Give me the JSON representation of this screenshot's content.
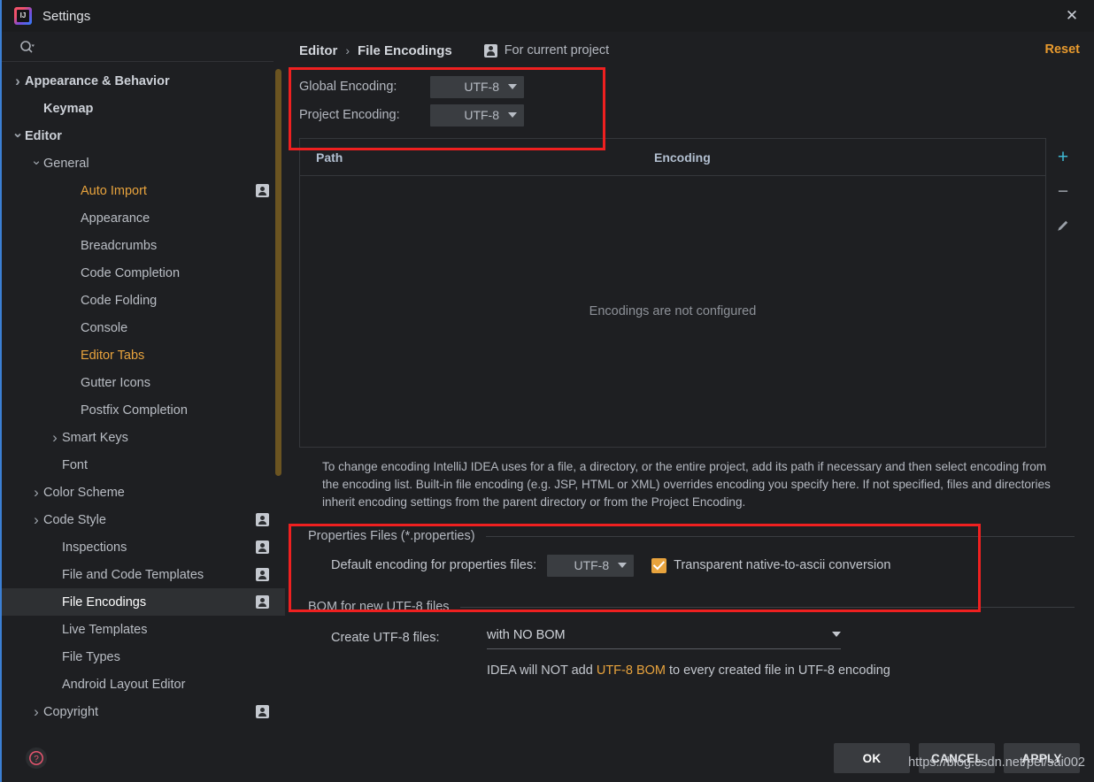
{
  "window": {
    "title": "Settings",
    "logo_icon": "intellij-idea-logo",
    "close_icon": "close-icon"
  },
  "sidebar": {
    "search": {
      "icon": "search-icon",
      "placeholder": ""
    },
    "items": [
      {
        "label": "Appearance & Behavior",
        "indent": 0,
        "twisty": "right",
        "bold": true,
        "badge": false,
        "state": "normal"
      },
      {
        "label": "Keymap",
        "indent": 1,
        "twisty": "none",
        "bold": true,
        "badge": false,
        "state": "normal"
      },
      {
        "label": "Editor",
        "indent": 0,
        "twisty": "down",
        "bold": true,
        "badge": false,
        "state": "normal"
      },
      {
        "label": "General",
        "indent": 1,
        "twisty": "down",
        "bold": false,
        "badge": false,
        "state": "normal"
      },
      {
        "label": "Auto Import",
        "indent": 3,
        "twisty": "none",
        "bold": false,
        "badge": true,
        "state": "orange"
      },
      {
        "label": "Appearance",
        "indent": 3,
        "twisty": "none",
        "bold": false,
        "badge": false,
        "state": "normal"
      },
      {
        "label": "Breadcrumbs",
        "indent": 3,
        "twisty": "none",
        "bold": false,
        "badge": false,
        "state": "normal"
      },
      {
        "label": "Code Completion",
        "indent": 3,
        "twisty": "none",
        "bold": false,
        "badge": false,
        "state": "normal"
      },
      {
        "label": "Code Folding",
        "indent": 3,
        "twisty": "none",
        "bold": false,
        "badge": false,
        "state": "normal"
      },
      {
        "label": "Console",
        "indent": 3,
        "twisty": "none",
        "bold": false,
        "badge": false,
        "state": "normal"
      },
      {
        "label": "Editor Tabs",
        "indent": 3,
        "twisty": "none",
        "bold": false,
        "badge": false,
        "state": "orange"
      },
      {
        "label": "Gutter Icons",
        "indent": 3,
        "twisty": "none",
        "bold": false,
        "badge": false,
        "state": "normal"
      },
      {
        "label": "Postfix Completion",
        "indent": 3,
        "twisty": "none",
        "bold": false,
        "badge": false,
        "state": "normal"
      },
      {
        "label": "Smart Keys",
        "indent": 2,
        "twisty": "right",
        "bold": false,
        "badge": false,
        "state": "normal"
      },
      {
        "label": "Font",
        "indent": 2,
        "twisty": "none",
        "bold": false,
        "badge": false,
        "state": "normal"
      },
      {
        "label": "Color Scheme",
        "indent": 1,
        "twisty": "right",
        "bold": false,
        "badge": false,
        "state": "normal"
      },
      {
        "label": "Code Style",
        "indent": 1,
        "twisty": "right",
        "bold": false,
        "badge": true,
        "state": "normal"
      },
      {
        "label": "Inspections",
        "indent": 2,
        "twisty": "none",
        "bold": false,
        "badge": true,
        "state": "normal"
      },
      {
        "label": "File and Code Templates",
        "indent": 2,
        "twisty": "none",
        "bold": false,
        "badge": true,
        "state": "normal"
      },
      {
        "label": "File Encodings",
        "indent": 2,
        "twisty": "none",
        "bold": false,
        "badge": true,
        "state": "selected"
      },
      {
        "label": "Live Templates",
        "indent": 2,
        "twisty": "none",
        "bold": false,
        "badge": false,
        "state": "normal"
      },
      {
        "label": "File Types",
        "indent": 2,
        "twisty": "none",
        "bold": false,
        "badge": false,
        "state": "normal"
      },
      {
        "label": "Android Layout Editor",
        "indent": 2,
        "twisty": "none",
        "bold": false,
        "badge": false,
        "state": "normal"
      },
      {
        "label": "Copyright",
        "indent": 1,
        "twisty": "right",
        "bold": false,
        "badge": true,
        "state": "normal"
      }
    ],
    "help_icon": "help-question-icon"
  },
  "header": {
    "breadcrumb_parent": "Editor",
    "breadcrumb_separator": "›",
    "breadcrumb_current": "File Encodings",
    "scope_badge_icon": "project-scope-icon",
    "scope_label": "For current project",
    "reset_label": "Reset",
    "reset_color": "#e89a2e"
  },
  "encodings": {
    "global_label": "Global Encoding:",
    "global_value": "UTF-8",
    "project_label": "Project Encoding:",
    "project_value": "UTF-8"
  },
  "table": {
    "columns": [
      "Path",
      "Encoding"
    ],
    "rows": [],
    "empty_message": "Encodings are not configured",
    "toolbar": [
      {
        "icon": "add-icon",
        "glyph": "+",
        "color": "#3fb9d4"
      },
      {
        "icon": "remove-icon",
        "glyph": "−",
        "color": "#9aa0a8"
      },
      {
        "icon": "edit-pencil-icon",
        "glyph": "",
        "color": "#9aa0a8"
      }
    ]
  },
  "description": "To change encoding IntelliJ IDEA uses for a file, a directory, or the entire project, add its path if necessary and then select encoding from the encoding list. Built-in file encoding (e.g. JSP, HTML or XML) overrides encoding you specify here. If not specified, files and directories inherit encoding settings from the parent directory or from the Project Encoding.",
  "properties_section": {
    "title": "Properties Files (*.properties)",
    "encoding_label": "Default encoding for properties files:",
    "encoding_value": "UTF-8",
    "checkbox_label": "Transparent native-to-ascii conversion",
    "checkbox_checked": true,
    "checkbox_color": "#e8a33d"
  },
  "bom_section": {
    "title": "BOM for new UTF-8 files",
    "create_label": "Create UTF-8 files:",
    "create_value": "with NO BOM",
    "note_prefix": "IDEA will NOT add ",
    "note_highlight": "UTF-8 BOM",
    "note_suffix": " to every created file in UTF-8 encoding",
    "highlight_color": "#e8a33d"
  },
  "footer": {
    "ok_label": "OK",
    "cancel_label": "CANCEL",
    "apply_label": "APPLY",
    "watermark": "https://blog.csdn.net/pei/sai002"
  },
  "annotations": {
    "color": "#ef2020",
    "boxes": [
      "encoding-dropdowns-highlight",
      "properties-files-highlight"
    ]
  }
}
